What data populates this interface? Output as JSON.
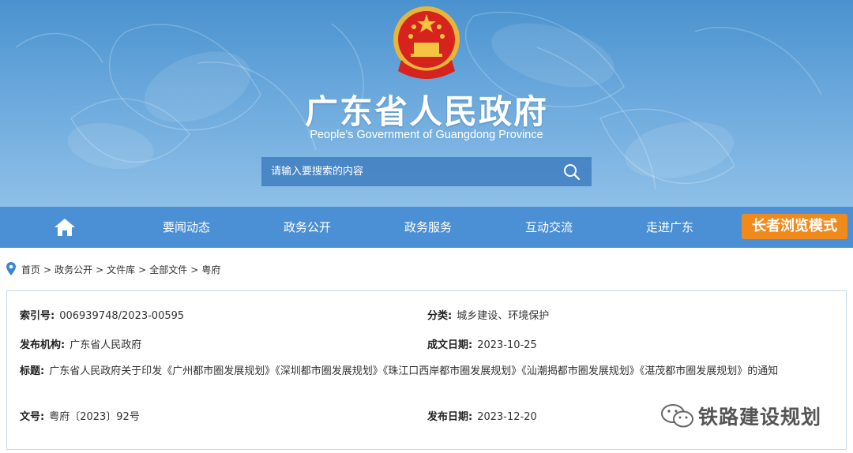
{
  "header": {
    "title": "广东省人民政府",
    "subtitle": "People's Government of Guangdong Province",
    "emblem_icon": "national-emblem-icon"
  },
  "search": {
    "placeholder": "请输入要搜索的内容",
    "icon": "search-icon"
  },
  "nav": {
    "home_icon": "home-icon",
    "items": [
      "要闻动态",
      "政务公开",
      "政务服务",
      "互动交流",
      "走进广东"
    ],
    "elder_mode": "长者浏览模式",
    "bg_color": "#4b90d4",
    "elder_color": "#f08a1c"
  },
  "breadcrumb": [
    "首页",
    "政务公开",
    "文件库",
    "全部文件",
    "粤府"
  ],
  "doc": {
    "index_label": "索引号:",
    "index_value": "006939748/2023-00595",
    "category_label": "分类:",
    "category_value": "城乡建设、环境保护",
    "publisher_label": "发布机构:",
    "publisher_value": "广东省人民政府",
    "created_label": "成文日期:",
    "created_value": "2023-10-25",
    "title_label": "标题:",
    "title_value": "广东省人民政府关于印发《广州都市圈发展规划》《深圳都市圈发展规划》《珠江口西岸都市圈发展规划》《汕潮揭都市圈发展规划》《湛茂都市圈发展规划》的通知",
    "docno_label": "文号:",
    "docno_value": "粤府〔2023〕92号",
    "pubdate_label": "发布日期:",
    "pubdate_value": "2023-12-20"
  },
  "watermark": {
    "text": "铁路建设规划",
    "icon": "wechat-icon"
  }
}
